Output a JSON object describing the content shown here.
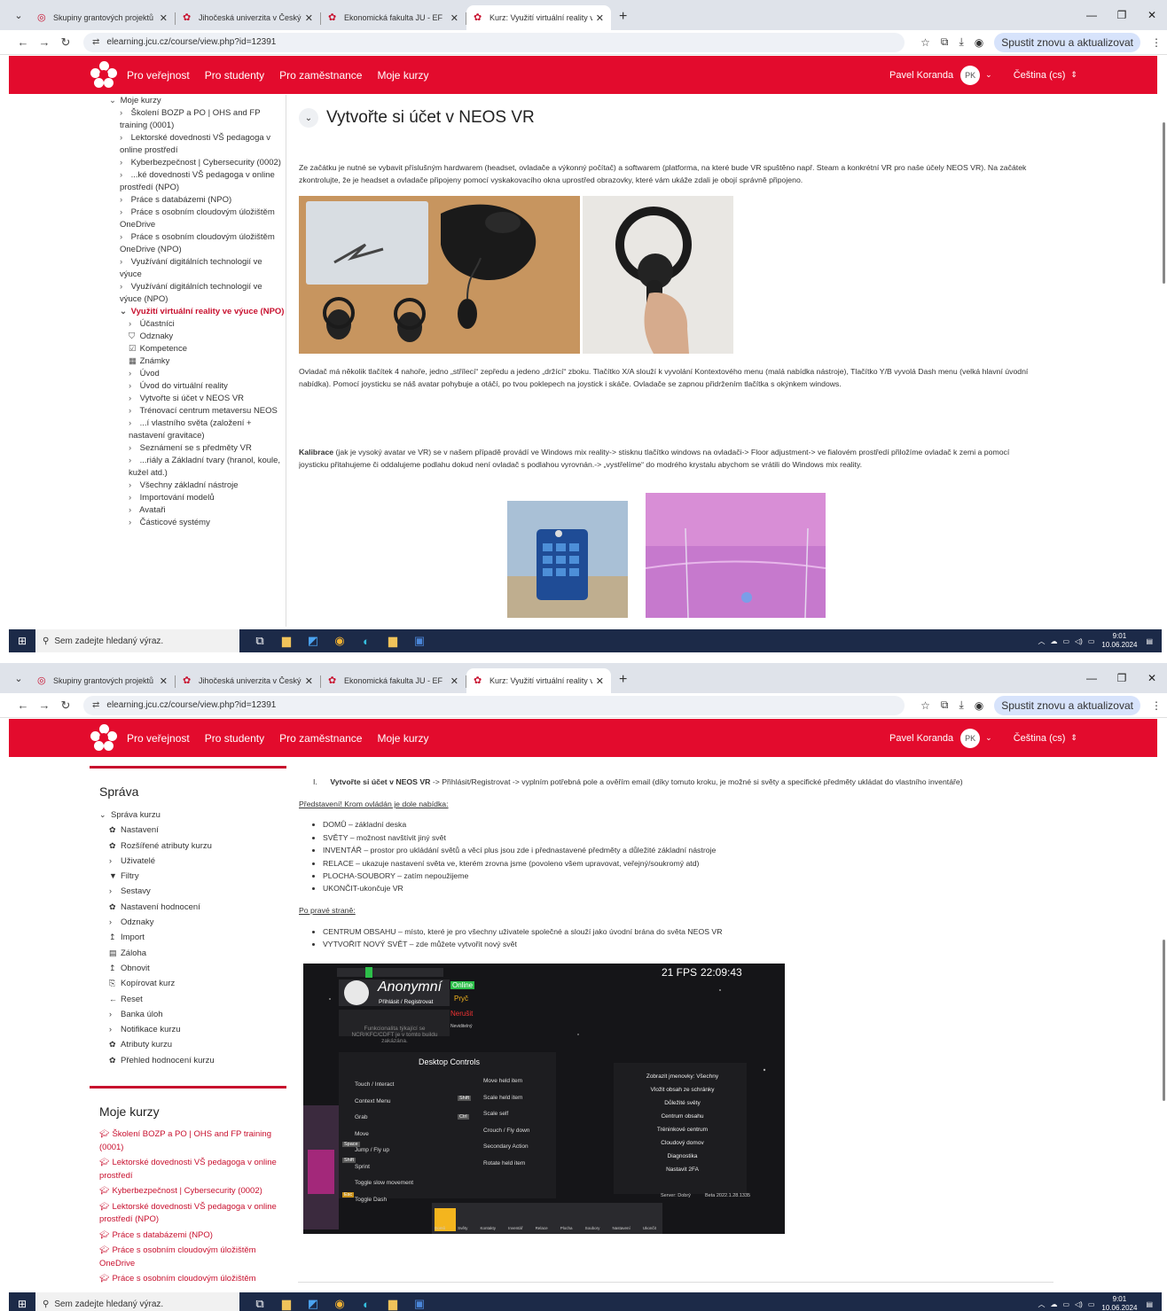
{
  "browser": {
    "tabs": [
      {
        "title": "Skupiny grantových projektů - ",
        "active": false
      },
      {
        "title": "Jihočeská univerzita v Českých ",
        "active": false
      },
      {
        "title": "Ekonomická fakulta JU - EF",
        "active": false
      },
      {
        "title": "Kurz: Využití virtuální reality ve ",
        "active": true
      }
    ],
    "url": "elearning.jcu.cz/course/view.php?id=12391",
    "update_button": "Spustit znovu a aktualizovat"
  },
  "header": {
    "nav": [
      "Pro veřejnost",
      "Pro studenty",
      "Pro zaměstnance",
      "Moje kurzy"
    ],
    "user_name": "Pavel Koranda",
    "avatar_initials": "PK",
    "language": "Čeština (cs)"
  },
  "drawer1": {
    "items": [
      {
        "level": 0,
        "chev": "⌄",
        "label": "Moje kurzy"
      },
      {
        "level": 1,
        "chev": "›",
        "label": "Školení BOZP a PO | OHS and FP training (0001)"
      },
      {
        "level": 1,
        "chev": "›",
        "label": "Lektorské dovednosti VŠ pedagoga v online prostředí"
      },
      {
        "level": 1,
        "chev": "›",
        "label": "Kyberbezpečnost | Cybersecurity (0002)"
      },
      {
        "level": 1,
        "chev": "›",
        "label": "...ké dovednosti VŠ pedagoga v online prostředí (NPO)"
      },
      {
        "level": 1,
        "chev": "›",
        "label": "Práce s databázemi (NPO)"
      },
      {
        "level": 1,
        "chev": "›",
        "label": "Práce s osobním cloudovým úložištěm OneDrive"
      },
      {
        "level": 1,
        "chev": "›",
        "label": "Práce s osobním cloudovým úložištěm OneDrive (NPO)"
      },
      {
        "level": 1,
        "chev": "›",
        "label": "Využívání digitálních technologií ve výuce"
      },
      {
        "level": 1,
        "chev": "›",
        "label": "Využívání digitálních technologií ve výuce (NPO)"
      },
      {
        "level": 1,
        "chev": "⌄",
        "label": "Využití virtuální reality ve výuce (NPO)",
        "selected": true
      },
      {
        "level": 2,
        "chev": "›",
        "label": "Účastníci"
      },
      {
        "level": 2,
        "chev": "⛉",
        "label": "Odznaky"
      },
      {
        "level": 2,
        "chev": "☑",
        "label": "Kompetence"
      },
      {
        "level": 2,
        "chev": "▦",
        "label": "Známky"
      },
      {
        "level": 2,
        "chev": "›",
        "label": "Úvod"
      },
      {
        "level": 2,
        "chev": "›",
        "label": "Úvod do virtuální reality"
      },
      {
        "level": 2,
        "chev": "›",
        "label": "Vytvořte si účet v NEOS VR"
      },
      {
        "level": 2,
        "chev": "›",
        "label": "Trénovací centrum metaversu NEOS"
      },
      {
        "level": 2,
        "chev": "›",
        "label": "...í vlastního světa (založení + nastavení gravitace)"
      },
      {
        "level": 2,
        "chev": "›",
        "label": "Seznámení se s předměty VR"
      },
      {
        "level": 2,
        "chev": "›",
        "label": "...riály a Základní tvary (hranol, koule, kužel atd.)"
      },
      {
        "level": 2,
        "chev": "›",
        "label": "Všechny základní nástroje"
      },
      {
        "level": 2,
        "chev": "›",
        "label": "Importování modelů"
      },
      {
        "level": 2,
        "chev": "›",
        "label": "Avataři"
      },
      {
        "level": 2,
        "chev": "›",
        "label": "Částicové systémy"
      }
    ]
  },
  "content1": {
    "title": "Vytvořte si účet v NEOS VR",
    "intro": "Ze začátku je nutné se vybavit příslušným hardwarem (headset, ovladače a výkonný počítač) a softwarem (platforma, na které bude VR spuštěno např. Steam a konkrétní VR pro naše účely NEOS VR). Na začátek zkontrolujte, že je headset a ovladače připojeny pomocí vyskakovacího okna uprostřed obrazovky, které vám ukáže zdali je obojí správně připojeno.",
    "controller_text": "Ovladač má několik tlačítek 4 nahoře, jedno „střílecí“ zepředu a jedeno „držící“ zboku. Tlačítko X/A slouží k vyvolání Kontextového menu (malá nabídka nástroje), Tlačítko Y/B vyvolá Dash menu (velká hlavní úvodní nabídka). Pomocí joysticku se náš avatar pohybuje a otáčí, po tvou poklepech na joystick i skáče. Ovladače se zapnou přidržením tlačítka s okýnkem windows.",
    "calib_bold": "Kalibrace",
    "calib_text": " (jak je vysoký avatar ve VR) se v našem případě provádí ve Windows mix reality-> stisknu tlačítko windows na ovladači-> Floor adjustment-> ve fialovém prostředí přiložíme ovladač k zemi a pomocí joysticku přitahujeme či oddalujeme podlahu dokud není ovladač s podlahou vyrovnán.-> „vystřelíme“ do modrého krystalu abychom se vrátili do Windows mix reality."
  },
  "taskbar": {
    "search_placeholder": "Sem zadejte hledaný výraz.",
    "time": "9:01",
    "date": "10.06.2024"
  },
  "drawer2": {
    "admin_title": "Správa",
    "admin_items": [
      {
        "icon": "⌄",
        "label": "Správa kurzu",
        "sub": false
      },
      {
        "icon": "✿",
        "label": "Nastavení",
        "sub": true
      },
      {
        "icon": "✿",
        "label": "Rozšířené atributy kurzu",
        "sub": true
      },
      {
        "icon": "›",
        "label": "Uživatelé",
        "sub": true
      },
      {
        "icon": "▼",
        "label": "Filtry",
        "sub": true
      },
      {
        "icon": "›",
        "label": "Sestavy",
        "sub": true
      },
      {
        "icon": "✿",
        "label": "Nastavení hodnocení",
        "sub": true
      },
      {
        "icon": "›",
        "label": "Odznaky",
        "sub": true
      },
      {
        "icon": "↥",
        "label": "Import",
        "sub": true
      },
      {
        "icon": "▤",
        "label": "Záloha",
        "sub": true
      },
      {
        "icon": "↥",
        "label": "Obnovit",
        "sub": true
      },
      {
        "icon": "⎘",
        "label": "Kopírovat kurz",
        "sub": true
      },
      {
        "icon": "←",
        "label": "Reset",
        "sub": true
      },
      {
        "icon": "›",
        "label": "Banka úloh",
        "sub": true
      },
      {
        "icon": "›",
        "label": "Notifikace kurzu",
        "sub": true
      },
      {
        "icon": "✿",
        "label": "Atributy kurzu",
        "sub": true
      },
      {
        "icon": "✿",
        "label": "Přehled hodnocení kurzu",
        "sub": true
      }
    ],
    "courses_title": "Moje kurzy",
    "courses": [
      "Školení BOZP a PO | OHS and FP training (0001)",
      "Lektorské dovednosti VŠ pedagoga v online prostředí",
      "Kyberbezpečnost | Cybersecurity (0002)",
      "Lektorské dovednosti VŠ pedagoga v online prostředí (NPO)",
      "Práce s databázemi (NPO)",
      "Práce s osobním cloudovým úložištěm OneDrive",
      "Práce s osobním cloudovým úložištěm OneDrive (NPO)"
    ]
  },
  "content2": {
    "step_num": "I.",
    "step_bold": "Vytvořte si účet v NEOS VR",
    "step_text": " -> Přihlásit/Registrovat -> vyplním potřebná pole a ověřím email (díky tomuto kroku, je možné si světy a specifické předměty ukládat do vlastního inventáře)",
    "intro_heading": "Představení! Krom ovládán je dole nabídka:",
    "bottom_menu": [
      "DOMŮ – základní deska",
      "SVĚTY – možnost navštívit jiný svět",
      "INVENTÁŘ – prostor pro ukládání světů a věcí plus jsou zde i přednastavené předměty a důležité základní nástroje",
      "RELACE – ukazuje nastavení světa ve, kterém zrovna jsme (povoleno všem upravovat, veřejný/soukromý atd)",
      "PLOCHA-SOUBORY – zatím nepoužijeme",
      "UKONČIT-ukončuje VR"
    ],
    "right_heading": "Po pravé straně:",
    "right_items": [
      "CENTRUM OBSAHU – místo, které je pro všechny uživatele společné a slouží jako úvodní brána do světa NEOS VR",
      "VYTVOŘIT NOVÝ SVĚT – zde můžete vytvořit nový svět"
    ]
  },
  "vr": {
    "fps": "21 FPS",
    "clock": "22:09:43",
    "name": "Anonymní",
    "login": "Přihlásit / Registrovat",
    "status": [
      "Online",
      "Pryč",
      "Nerušit",
      "Neviditelný"
    ],
    "notice": "Funkcionalita týkající se NCR/KFC/CDFT je v tomto buildu zakázána.",
    "controls_title": "Desktop Controls",
    "controls_left": [
      "Touch / Interact",
      "Context Menu",
      "Grab",
      "Move",
      "Jump / Fly up",
      "Sprint",
      "Toggle slow movement",
      "Toggle Dash"
    ],
    "controls_right": [
      "Move held item",
      "Scale held item",
      "Scale self",
      "Crouch / Fly down",
      "Secondary Action",
      "Rotate held item"
    ],
    "keys": [
      "Shift",
      "Ctrl",
      "Space",
      "Shift",
      "Esc"
    ],
    "right_panel": [
      "Zobrazit jmenovky: Všechny",
      "Vložit obsah ze schránky",
      "Důležité světy",
      "Centrum obsahu",
      "Tréninkové centrum",
      "Cloudový domov",
      "Diagnostika",
      "Nastavit 2FA"
    ],
    "server": "Server: Dobrý",
    "version": "Beta 2022.1.28.1335",
    "dock": [
      "Domů",
      "Světy",
      "Kontakty",
      "Inventář",
      "Relace",
      "Plocha",
      "Soubory",
      "Nastavení",
      "Ukončit"
    ]
  }
}
